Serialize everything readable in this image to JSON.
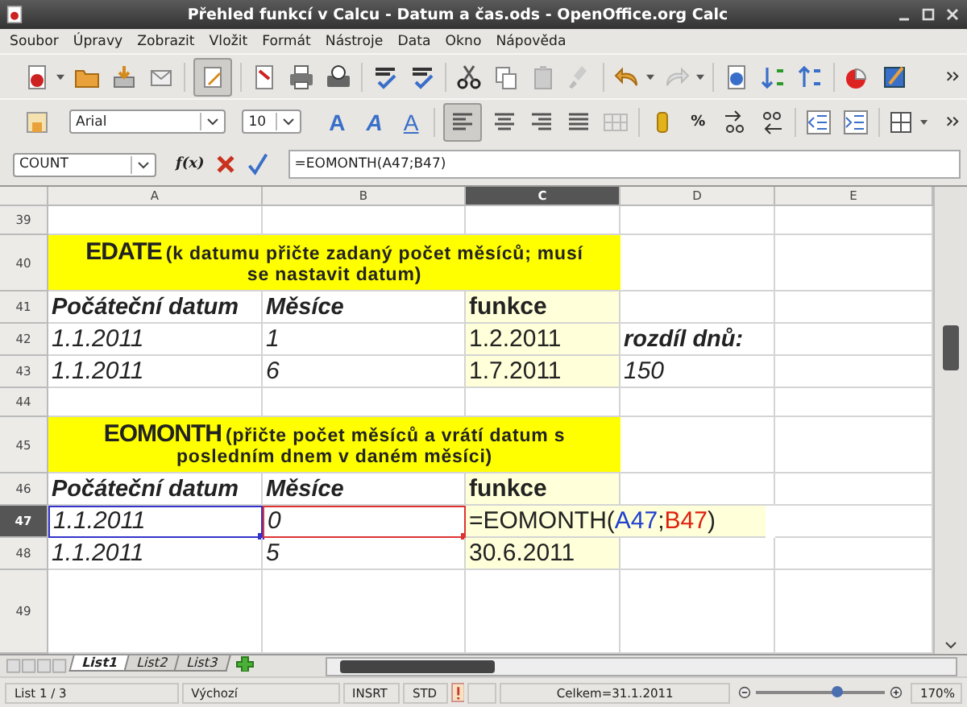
{
  "window": {
    "title": "Přehled funkcí v Calcu - Datum a čas.ods - OpenOffice.org Calc"
  },
  "menu": [
    "Soubor",
    "Úpravy",
    "Zobrazit",
    "Vložit",
    "Formát",
    "Nástroje",
    "Data",
    "Okno",
    "Nápověda"
  ],
  "standard_toolbar": {
    "edit_mode_on": true
  },
  "format_toolbar": {
    "font": "Arial",
    "size": "10",
    "style_buttons": [
      {
        "label": "A",
        "kind": "bold"
      },
      {
        "label": "A",
        "kind": "italic"
      },
      {
        "label": "A",
        "kind": "underline"
      }
    ],
    "align_left_on": true,
    "percent": "%"
  },
  "formula_bar": {
    "name_box": "COUNT",
    "function_button": "f(x)",
    "formula": "=EOMONTH(A47;B47)"
  },
  "sheet": {
    "columns": [
      {
        "label": "A",
        "selected": false
      },
      {
        "label": "B",
        "selected": false
      },
      {
        "label": "C",
        "selected": true
      },
      {
        "label": "D",
        "selected": false
      },
      {
        "label": "E",
        "selected": false
      }
    ],
    "rows": [
      {
        "number": "39",
        "kind": "empty",
        "selected": false
      },
      {
        "number": "40",
        "kind": "heading",
        "selected": false,
        "title": "EDATE",
        "note": "(k datumu přičte zadaný počet měsíců; musí se nastavit datum)"
      },
      {
        "number": "41",
        "kind": "data",
        "selected": false,
        "cells": {
          "A": {
            "text": "Počáteční datum",
            "kind": "bold_italic"
          },
          "B": {
            "text": "Měsíce",
            "kind": "bold_italic"
          },
          "C": {
            "text": "funkce",
            "kind": "bold",
            "highlighted": true
          }
        }
      },
      {
        "number": "42",
        "kind": "data",
        "selected": false,
        "cells": {
          "A": {
            "text": "1.1.2011",
            "kind": "italic"
          },
          "B": {
            "text": "1",
            "kind": "italic"
          },
          "C": {
            "text": "1.2.2011",
            "kind": "plain",
            "highlighted": true
          },
          "D": {
            "text": "rozdíl dnů:",
            "kind": "bold_italic"
          }
        }
      },
      {
        "number": "43",
        "kind": "data",
        "selected": false,
        "cells": {
          "A": {
            "text": "1.1.2011",
            "kind": "italic"
          },
          "B": {
            "text": "6",
            "kind": "italic"
          },
          "C": {
            "text": "1.7.2011",
            "kind": "plain",
            "highlighted": true
          },
          "D": {
            "text": "150",
            "kind": "italic"
          }
        }
      },
      {
        "number": "44",
        "kind": "empty",
        "selected": false
      },
      {
        "number": "45",
        "kind": "heading",
        "selected": false,
        "title": "EOMONTH",
        "note": "(přičte počet měsíců a vrátí datum s posledním dnem v daném měsíci)"
      },
      {
        "number": "46",
        "kind": "data",
        "selected": false,
        "cells": {
          "A": {
            "text": "Počáteční datum",
            "kind": "bold_italic"
          },
          "B": {
            "text": "Měsíce",
            "kind": "bold_italic"
          },
          "C": {
            "text": "funkce",
            "kind": "bold",
            "highlighted": true
          }
        }
      },
      {
        "number": "47",
        "kind": "data",
        "selected": true,
        "cells": {
          "A": {
            "text": "1.1.2011",
            "kind": "italic",
            "color": "#3333cc"
          },
          "B": {
            "text": "0",
            "kind": "italic",
            "color": "#dd3333"
          },
          "C": {
            "kind": "formula",
            "highlighted": true,
            "parts": [
              {
                "text": "=EOMONTH("
              },
              {
                "text": "A47",
                "color": "#1f3fd0"
              },
              {
                "text": ";"
              },
              {
                "text": "B47",
                "color": "#e02010"
              },
              {
                "text": ")"
              }
            ]
          }
        }
      },
      {
        "number": "48",
        "kind": "data",
        "selected": false,
        "cells": {
          "A": {
            "text": "1.1.2011",
            "kind": "italic"
          },
          "B": {
            "text": "5",
            "kind": "italic"
          },
          "C": {
            "text": "30.6.2011",
            "kind": "plain",
            "highlighted": true
          }
        }
      },
      {
        "number": "49",
        "kind": "empty",
        "selected": false
      }
    ]
  },
  "sheet_tabs": [
    {
      "label": "List1",
      "selected": true
    },
    {
      "label": "List2",
      "selected": false
    },
    {
      "label": "List3",
      "selected": false
    }
  ],
  "status_bar": {
    "sheet": "List 1 / 3",
    "page_style": "Výchozí",
    "insert_mode": "INSRT",
    "selection_mode": "STD",
    "sum": "Celkem=31.1.2011",
    "zoom": {
      "level": 0.62,
      "reading": "170%"
    }
  }
}
